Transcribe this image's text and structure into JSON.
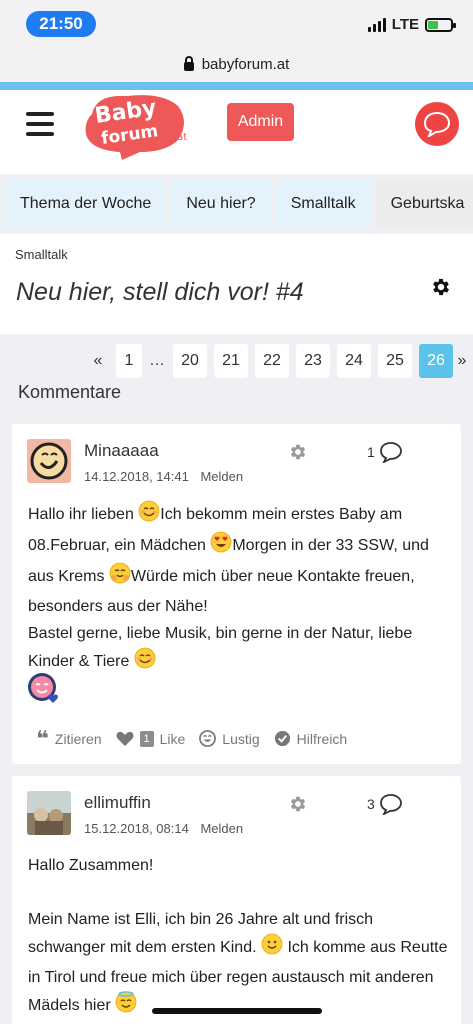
{
  "status": {
    "time": "21:50",
    "network": "LTE",
    "battery_level": 0.45
  },
  "browser": {
    "url": "babyforum.at"
  },
  "header": {
    "logo_line1": "Baby",
    "logo_line2": "forum",
    "logo_suffix": ".at",
    "admin_label": "Admin"
  },
  "tabs": [
    {
      "label": "Thema der Woche"
    },
    {
      "label": "Neu hier?"
    },
    {
      "label": "Smalltalk"
    },
    {
      "label": "Geburtska"
    }
  ],
  "breadcrumb": "Smalltalk",
  "page_title": "Neu hier, stell dich vor! #4",
  "pagination": {
    "prev": "«",
    "next": "»",
    "ellipsis": "…",
    "pages": [
      "1",
      "20",
      "21",
      "22",
      "23",
      "24",
      "25",
      "26"
    ],
    "current": "26"
  },
  "comments_heading": "Kommentare",
  "comments": [
    {
      "user": "Minaaaaa",
      "date": "14.12.2018, 14:41",
      "report": "Melden",
      "reply_count": "1",
      "body": [
        [
          "Hallo ihr lieben ",
          "smile",
          "Ich bekomm mein erstes Baby am 08.Februar, ein Mädchen ",
          "heart-eyes",
          "Morgen in der 33 SSW, und aus Krems ",
          "hug",
          "Würde mich über neue Kontakte freuen, besonders aus der Nähe!"
        ],
        [
          "Bastel gerne, liebe Musik, bin gerne in der Natur, liebe Kinder & Tiere ",
          "smile"
        ]
      ],
      "actions": {
        "quote": "Zitieren",
        "like_count": "1",
        "like": "Like",
        "funny": "Lustig",
        "helpful": "Hilfreich"
      }
    },
    {
      "user": "ellimuffin",
      "date": "15.12.2018, 08:14",
      "report": "Melden",
      "reply_count": "3",
      "body": [
        [
          "Hallo Zusammen!"
        ],
        [
          ""
        ],
        [
          "Mein Name ist Elli, ich bin 26 Jahre alt und frisch schwanger mit dem ersten Kind. ",
          "slight-smile",
          " Ich komme aus Reutte in Tirol und freue mich über regen austausch mit anderen Mädels hier ",
          "halo"
        ]
      ]
    }
  ],
  "colors": {
    "accent": "#5bc3ea",
    "brand_red": "#ef5859",
    "tab_bg": "#e4f3fb",
    "time_pill": "#1e7cf0"
  }
}
